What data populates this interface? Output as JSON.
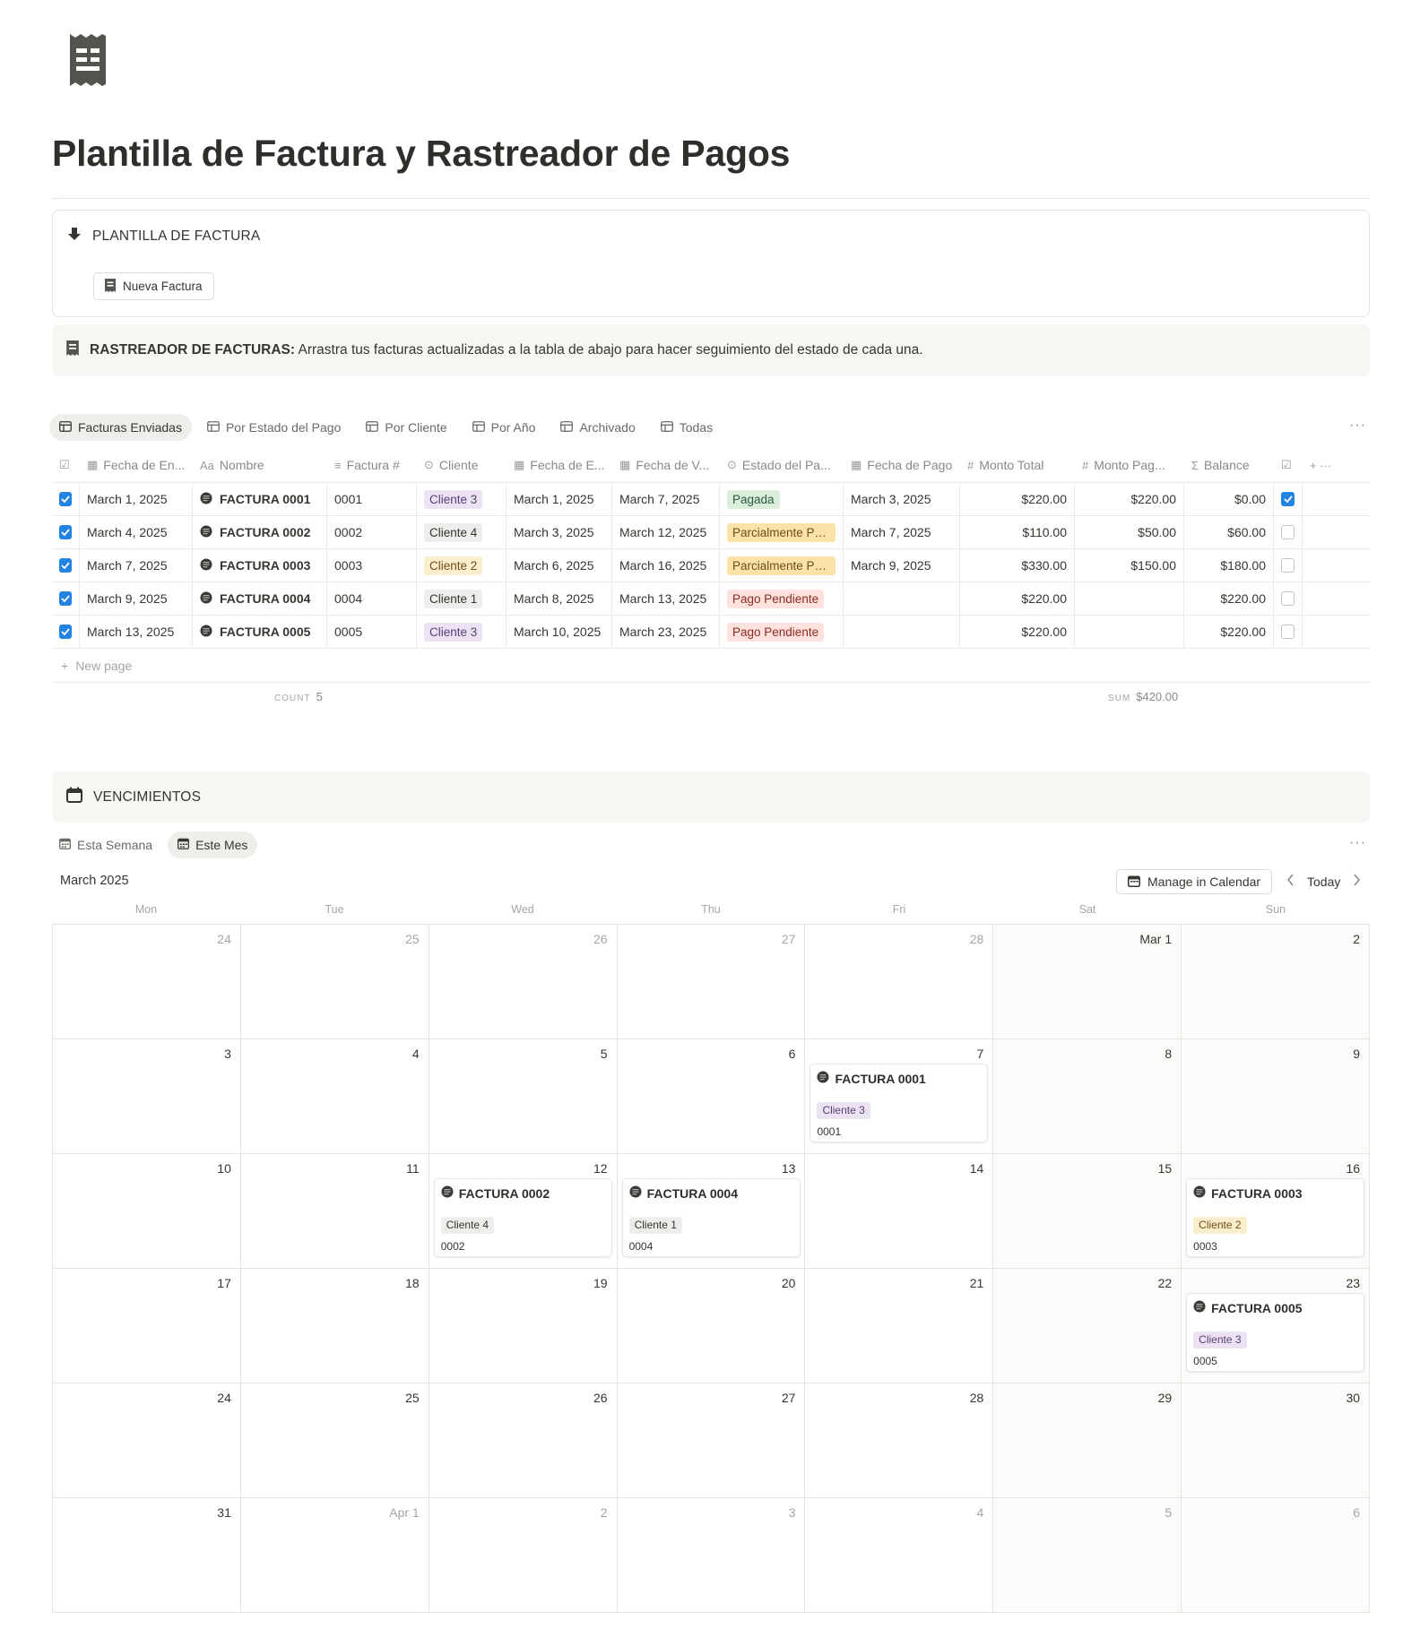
{
  "page": {
    "icon": "receipt-icon",
    "title": "Plantilla de Factura y Rastreador de Pagos"
  },
  "template_section": {
    "heading": "PLANTILLA DE FACTURA",
    "button_label": "Nueva Factura"
  },
  "callout": {
    "bold": "RASTREADOR DE FACTURAS:",
    "text": "Arrastra tus facturas actualizadas a la tabla de abajo para hacer seguimiento del estado de cada una."
  },
  "views": [
    {
      "label": "Facturas Enviadas",
      "active": true
    },
    {
      "label": "Por Estado del Pago",
      "active": false
    },
    {
      "label": "Por Cliente",
      "active": false
    },
    {
      "label": "Por Año",
      "active": false
    },
    {
      "label": "Archivado",
      "active": false
    },
    {
      "label": "Todas",
      "active": false
    }
  ],
  "table": {
    "columns": [
      "Fecha de En...",
      "Nombre",
      "Factura #",
      "Cliente",
      "Fecha de E...",
      "Fecha de V...",
      "Estado del Pa...",
      "Fecha de Pago",
      "Monto Total",
      "Monto Pag...",
      "Balance"
    ],
    "rows": [
      {
        "sent": "March 1, 2025",
        "name": "FACTURA 0001",
        "number": "0001",
        "client": "Cliente 3",
        "issued": "March 1, 2025",
        "due": "March 7, 2025",
        "status": "Pagada",
        "paid_date": "March 3, 2025",
        "total": "$220.00",
        "paid": "$220.00",
        "balance": "$0.00",
        "done": true
      },
      {
        "sent": "March 4, 2025",
        "name": "FACTURA 0002",
        "number": "0002",
        "client": "Cliente 4",
        "issued": "March 3, 2025",
        "due": "March 12, 2025",
        "status": "Parcialmente Pa...",
        "paid_date": "March 7, 2025",
        "total": "$110.00",
        "paid": "$50.00",
        "balance": "$60.00",
        "done": false
      },
      {
        "sent": "March 7, 2025",
        "name": "FACTURA 0003",
        "number": "0003",
        "client": "Cliente 2",
        "issued": "March 6, 2025",
        "due": "March 16, 2025",
        "status": "Parcialmente Pa...",
        "paid_date": "March 9, 2025",
        "total": "$330.00",
        "paid": "$150.00",
        "balance": "$180.00",
        "done": false
      },
      {
        "sent": "March 9, 2025",
        "name": "FACTURA 0004",
        "number": "0004",
        "client": "Cliente 1",
        "issued": "March 8, 2025",
        "due": "March 13, 2025",
        "status": "Pago Pendiente",
        "paid_date": "",
        "total": "$220.00",
        "paid": "",
        "balance": "$220.00",
        "done": false
      },
      {
        "sent": "March 13, 2025",
        "name": "FACTURA 0005",
        "number": "0005",
        "client": "Cliente 3",
        "issued": "March 10, 2025",
        "due": "March 23, 2025",
        "status": "Pago Pendiente",
        "paid_date": "",
        "total": "$220.00",
        "paid": "",
        "balance": "$220.00",
        "done": false
      }
    ],
    "new_page_label": "New page",
    "count_label": "COUNT",
    "count_value": "5",
    "sum_label": "SUM",
    "sum_value": "$420.00"
  },
  "tag_colors": {
    "Cliente 1": {
      "bg": "#eeedeb",
      "fg": "#37352f"
    },
    "Cliente 2": {
      "bg": "#fbeecc",
      "fg": "#6f4d15"
    },
    "Cliente 3": {
      "bg": "#ebe2f3",
      "fg": "#5a3f74"
    },
    "Cliente 4": {
      "bg": "#eeedeb",
      "fg": "#37352f"
    },
    "Pagada": {
      "bg": "#dbeddb",
      "fg": "#2b593f"
    },
    "Parcialmente Pa...": {
      "bg": "#fbe3a8",
      "fg": "#6f4d15"
    },
    "Pago Pendiente": {
      "bg": "#ffe2dd",
      "fg": "#8a2b24"
    }
  },
  "calendar": {
    "heading": "VENCIMIENTOS",
    "views": [
      {
        "label": "Esta Semana",
        "active": false
      },
      {
        "label": "Este Mes",
        "active": true
      }
    ],
    "month_label": "March 2025",
    "manage_label": "Manage in Calendar",
    "today_label": "Today",
    "weekdays": [
      "Mon",
      "Tue",
      "Wed",
      "Thu",
      "Fri",
      "Sat",
      "Sun"
    ],
    "weeks": [
      [
        "24",
        "25",
        "26",
        "27",
        "28",
        "Mar 1",
        "2"
      ],
      [
        "3",
        "4",
        "5",
        "6",
        "7",
        "8",
        "9"
      ],
      [
        "10",
        "11",
        "12",
        "13",
        "14",
        "15",
        "16"
      ],
      [
        "17",
        "18",
        "19",
        "20",
        "21",
        "22",
        "23"
      ],
      [
        "24",
        "25",
        "26",
        "27",
        "28",
        "29",
        "30"
      ],
      [
        "31",
        "Apr 1",
        "2",
        "3",
        "4",
        "5",
        "6"
      ]
    ],
    "events": [
      {
        "week": 1,
        "day": 4,
        "title": "FACTURA 0001",
        "client": "Cliente 3",
        "number": "0001"
      },
      {
        "week": 2,
        "day": 2,
        "title": "FACTURA 0002",
        "client": "Cliente 4",
        "number": "0002"
      },
      {
        "week": 2,
        "day": 3,
        "title": "FACTURA 0004",
        "client": "Cliente 1",
        "number": "0004"
      },
      {
        "week": 2,
        "day": 6,
        "title": "FACTURA 0003",
        "client": "Cliente 2",
        "number": "0003"
      },
      {
        "week": 3,
        "day": 6,
        "title": "FACTURA 0005",
        "client": "Cliente 3",
        "number": "0005"
      }
    ]
  }
}
